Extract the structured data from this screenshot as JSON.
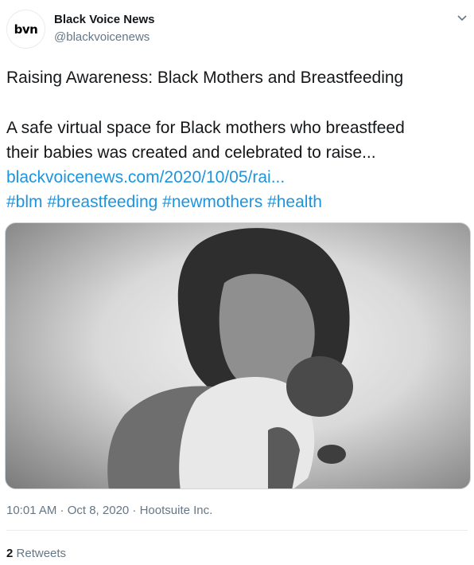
{
  "account": {
    "avatar_text": "bvn",
    "display_name": "Black Voice News",
    "handle": "@blackvoicenews"
  },
  "tweet": {
    "title": "Raising Awareness: Black Mothers and Breastfeeding",
    "body_line1": "A safe virtual space for Black mothers who breastfeed",
    "body_line2": "their babies was created and celebrated to raise...",
    "link": "blackvoicenews.com/2020/10/05/rai...",
    "hashtags": [
      "#blm",
      "#breastfeeding",
      "#newmothers",
      "#health"
    ],
    "timestamp": "10:01 AM · Oct 8, 2020 · Hootsuite Inc."
  },
  "stats": {
    "retweet_count": "2",
    "retweet_label": "Retweets"
  },
  "colors": {
    "link": "#1b95e0",
    "secondary_text": "#657786",
    "primary_text": "#14171a"
  },
  "icons": {
    "more": "chevron-down-icon"
  }
}
